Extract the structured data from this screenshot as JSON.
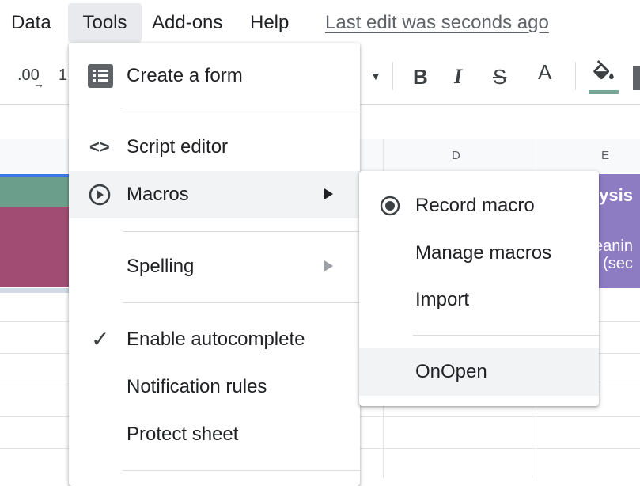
{
  "menubar": {
    "items": [
      "Data",
      "Tools",
      "Add-ons",
      "Help"
    ],
    "last_edit": "Last edit was seconds ago"
  },
  "toolbar": {
    "decimal_label": ".00",
    "decimal_arrow": "→",
    "format_fragment": "1",
    "bold": "B",
    "italic": "I",
    "strikethrough": "S",
    "text_color": "A",
    "fill_color_hex": "#78a797"
  },
  "grid": {
    "columns": [
      "D",
      "E"
    ],
    "purple_cell_title": "lysis",
    "purple_cell_text_1": "eanin",
    "purple_cell_text_2": "t (sec"
  },
  "tools_menu": {
    "create_form": "Create a form",
    "script_editor": "Script editor",
    "script_icon": "<>",
    "macros": "Macros",
    "spelling": "Spelling",
    "check": "✓",
    "enable_autocomplete": "Enable autocomplete",
    "notification_rules": "Notification rules",
    "protect_sheet": "Protect sheet"
  },
  "macros_submenu": {
    "record": "Record macro",
    "manage": "Manage macros",
    "import": "Import",
    "onopen": "OnOpen"
  },
  "colors": {
    "menu_hover": "#f1f3f4",
    "green_band": "#6b9f8b",
    "pink_band": "#a14d73",
    "purple_band": "#8e7cc3"
  }
}
